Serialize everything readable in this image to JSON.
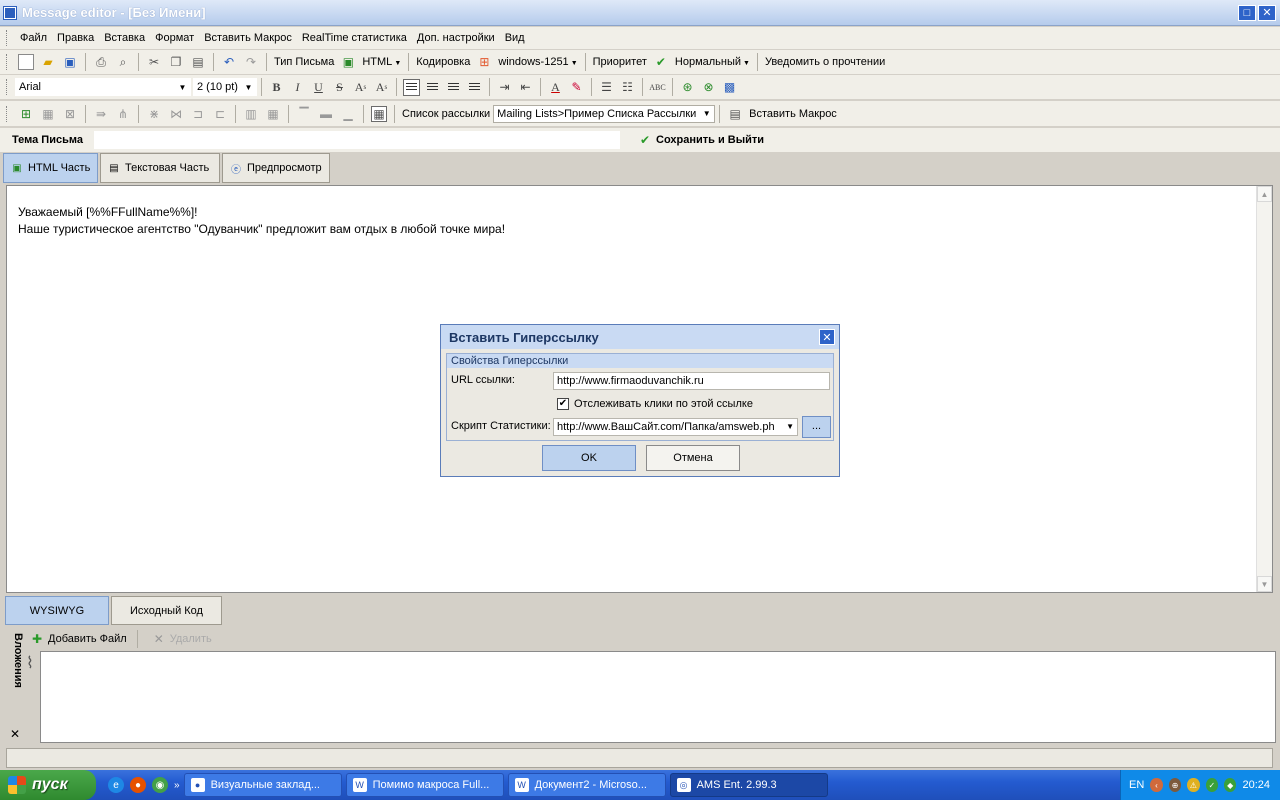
{
  "window": {
    "title": "Message editor - [Без Имени]"
  },
  "menu": [
    "Файл",
    "Правка",
    "Вставка",
    "Формат",
    "Вставить Макрос",
    "RealTime статистика",
    "Доп. настройки",
    "Вид"
  ],
  "toolbar1": {
    "letter_type": "Тип Письма",
    "html_label": "HTML",
    "encoding_label": "Кодировка",
    "encoding_value": "windows-1251",
    "priority_label": "Приоритет",
    "priority_value": "Нормальный",
    "notify_label": "Уведомить о прочтении"
  },
  "toolbar2": {
    "font": "Arial",
    "size": "2  (10 pt)"
  },
  "toolbar3": {
    "mailing_label": "Список рассылки",
    "mailing_value": "Mailing Lists>Пример Списка Рассылки",
    "insert_macro": "Вставить Макрос"
  },
  "subject": {
    "label": "Тема Письма",
    "value": "",
    "save_exit": "Сохранить и Выйти"
  },
  "tabs": [
    "HTML Часть",
    "Текстовая Часть",
    "Предпросмотр"
  ],
  "editor": {
    "line1": "Уважаемый [%%FFullName%%]!",
    "line2": "Наше туристическое агентство \"Одуванчик\" предложит вам отдых в любой точке мира!"
  },
  "mode_tabs": [
    "WYSIWYG",
    "Исходный Код"
  ],
  "attachments": {
    "label": "Вложения",
    "add": "Добавить Файл",
    "remove": "Удалить"
  },
  "dialog": {
    "title": "Вставить Гиперссылку",
    "group": "Свойства Гиперссылки",
    "url_label": "URL ссылки:",
    "url_value": "http://www.firmaoduvanchik.ru",
    "track_label": "Отслеживать клики по этой ссылке",
    "track_checked": true,
    "script_label": "Скрипт Статистики:",
    "script_value": "http://www.ВашСайт.com/Папка/amsweb.ph",
    "browse": "...",
    "ok": "OK",
    "cancel": "Отмена"
  },
  "taskbar": {
    "start": "пуск",
    "tasks": [
      "Визуальные заклад...",
      "Помимо макроса Full...",
      "Документ2 - Microso...",
      "AMS Ent. 2.99.3"
    ],
    "lang": "EN",
    "clock": "20:24"
  },
  "colors": {
    "accent": "#bcd2ee",
    "titlebar": "#b5cbec",
    "taskbar": "#245bd0"
  }
}
